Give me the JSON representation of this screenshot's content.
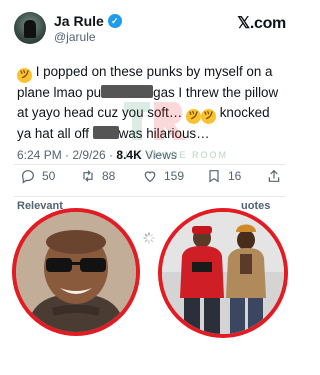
{
  "header": {
    "name": "Ja Rule",
    "handle": "@jarule",
    "brand": "𝕏.com",
    "verified_mark": "✓"
  },
  "tweet": {
    "part1": " I popped on these punks by myself on a plane lmao pu",
    "part2": "gas I threw the pillow at yayo head cuz you soft… ",
    "part3": " knocked ya hat all off ",
    "part4": "was hilarious…"
  },
  "meta": {
    "time": "6:24 PM · 2/9/26 · ",
    "views_count": "8.4K",
    "views_label": " Views"
  },
  "actions": {
    "replies": "50",
    "reposts": "88",
    "likes": "159",
    "bookmarks": "16"
  },
  "section": {
    "relevant": "Relevant",
    "quotes": "uotes"
  },
  "watermark": {
    "text": "THE SHADE ROOM",
    "color": "#2b8a57"
  },
  "colors": {
    "accent_blue": "#1d9bf0",
    "circle_border": "#e31b23",
    "muted": "#536471"
  },
  "icons": [
    "reply-icon",
    "repost-icon",
    "like-icon",
    "bookmark-icon",
    "share-icon",
    "verified-badge-icon"
  ]
}
